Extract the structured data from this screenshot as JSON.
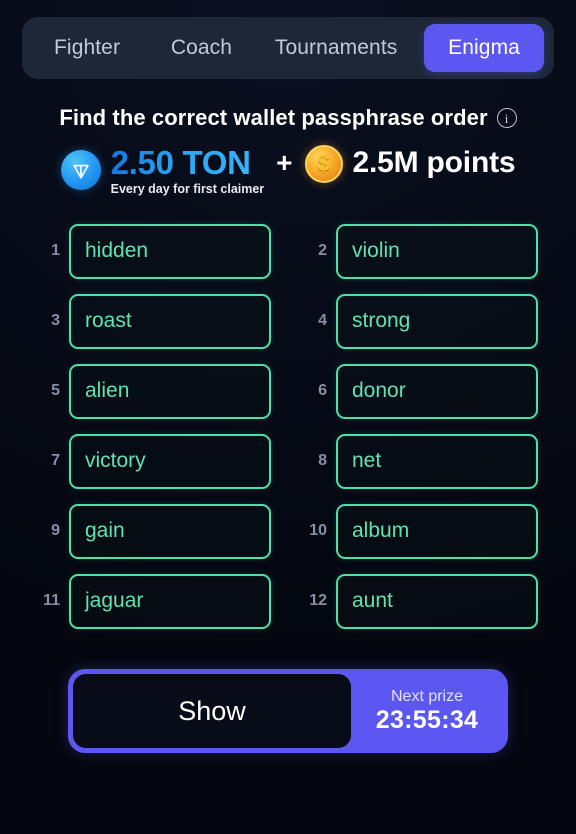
{
  "tabs": [
    {
      "label": "Fighter",
      "active": false
    },
    {
      "label": "Coach",
      "active": false
    },
    {
      "label": "Tournaments",
      "active": false
    },
    {
      "label": "Enigma",
      "active": true
    }
  ],
  "header": {
    "title": "Find the correct wallet passphrase order",
    "info_icon": "info-circle-icon"
  },
  "prize": {
    "ton_icon": "ton-coin-icon",
    "ton_amount": "2.50 TON",
    "ton_subtitle": "Every day for first claimer",
    "plus": "+",
    "points_icon": "dollar-coin-icon",
    "points_symbol": "$",
    "points_amount": "2.5M points"
  },
  "words": [
    {
      "index": "1",
      "word": "hidden"
    },
    {
      "index": "2",
      "word": "violin"
    },
    {
      "index": "3",
      "word": "roast"
    },
    {
      "index": "4",
      "word": "strong"
    },
    {
      "index": "5",
      "word": "alien"
    },
    {
      "index": "6",
      "word": "donor"
    },
    {
      "index": "7",
      "word": "victory"
    },
    {
      "index": "8",
      "word": "net"
    },
    {
      "index": "9",
      "word": "gain"
    },
    {
      "index": "10",
      "word": "album"
    },
    {
      "index": "11",
      "word": "jaguar"
    },
    {
      "index": "12",
      "word": "aunt"
    }
  ],
  "actions": {
    "show_label": "Show",
    "next_prize_label": "Next prize",
    "next_prize_timer": "23:55:34"
  },
  "colors": {
    "background": "#060a16",
    "tabbar_background": "#1d2737",
    "accent_purple": "#5b57f0",
    "word_green": "#4fdfa8",
    "ton_blue": "#1e93ef",
    "coin_gold": "#f5a623",
    "index_grey": "#868fa3"
  }
}
